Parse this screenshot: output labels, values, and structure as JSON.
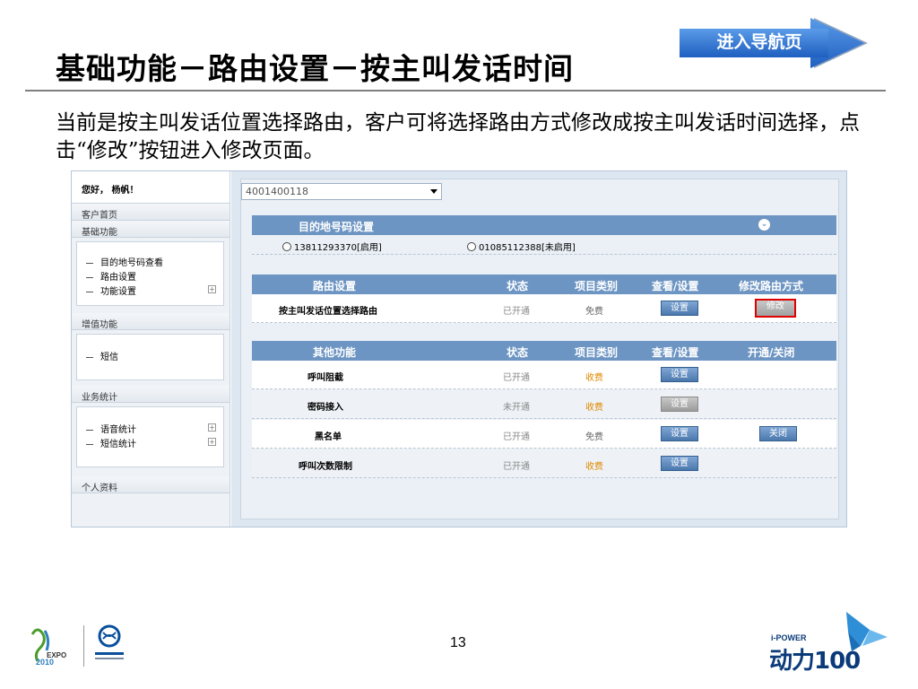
{
  "slide": {
    "title": "基础功能－路由设置－按主叫发话时间",
    "nav_button": "进入导航页",
    "intro": "当前是按主叫发话位置选择路由，客户可将选择路由方式修改成按主叫发话时间选择，点击“修改”按钮进入修改页面。",
    "page_number": "13"
  },
  "sidebar": {
    "greeting": "您好，  杨帆！",
    "home": "客户首页",
    "basic_header": "基础功能",
    "basic_items": [
      "目的地号码查看",
      "路由设置",
      "功能设置"
    ],
    "value_header": "增值功能",
    "value_items": [
      "短信"
    ],
    "stats_header": "业务统计",
    "stats_items": [
      "语音统计",
      "短信统计"
    ],
    "profile": "个人资料"
  },
  "main": {
    "number_select": "4001400118",
    "dest_panel": {
      "title": "目的地号码设置",
      "options": [
        "13811293370[启用]",
        "01085112388[未启用]"
      ]
    },
    "route_panel": {
      "headers": [
        "路由设置",
        "状态",
        "项目类别",
        "查看/设置",
        "修改路由方式"
      ],
      "row": {
        "name": "按主叫发话位置选择路由",
        "status": "已开通",
        "category": "免费",
        "set_button": "设置",
        "modify_button": "修改"
      }
    },
    "other_panel": {
      "headers": [
        "其他功能",
        "状态",
        "项目类别",
        "查看/设置",
        "开通/关闭"
      ],
      "rows": [
        {
          "name": "呼叫阻截",
          "status": "已开通",
          "category": "收费",
          "set_button": "设置",
          "toggle": ""
        },
        {
          "name": "密码接入",
          "status": "未开通",
          "category": "收费",
          "set_button": "设置",
          "toggle": ""
        },
        {
          "name": "黑名单",
          "status": "已开通",
          "category": "免费",
          "set_button": "设置",
          "toggle": "关闭"
        },
        {
          "name": "呼叫次数限制",
          "status": "已开通",
          "category": "收费",
          "set_button": "设置",
          "toggle": ""
        }
      ]
    }
  },
  "footer": {
    "brand_small": "i-POWER",
    "brand_big": "动力100"
  },
  "colors": {
    "panel_header": "#6d95c3",
    "paid_text": "#e08a00",
    "highlight": "#e00000",
    "nav_arrow": "#2f6fd0"
  },
  "icons": [
    "nav-arrow-icon",
    "expand-circle-icon",
    "dropdown-arrow-icon",
    "plus-icon",
    "expo-logo-icon",
    "china-mobile-logo-icon",
    "dongli-logo-icon"
  ]
}
